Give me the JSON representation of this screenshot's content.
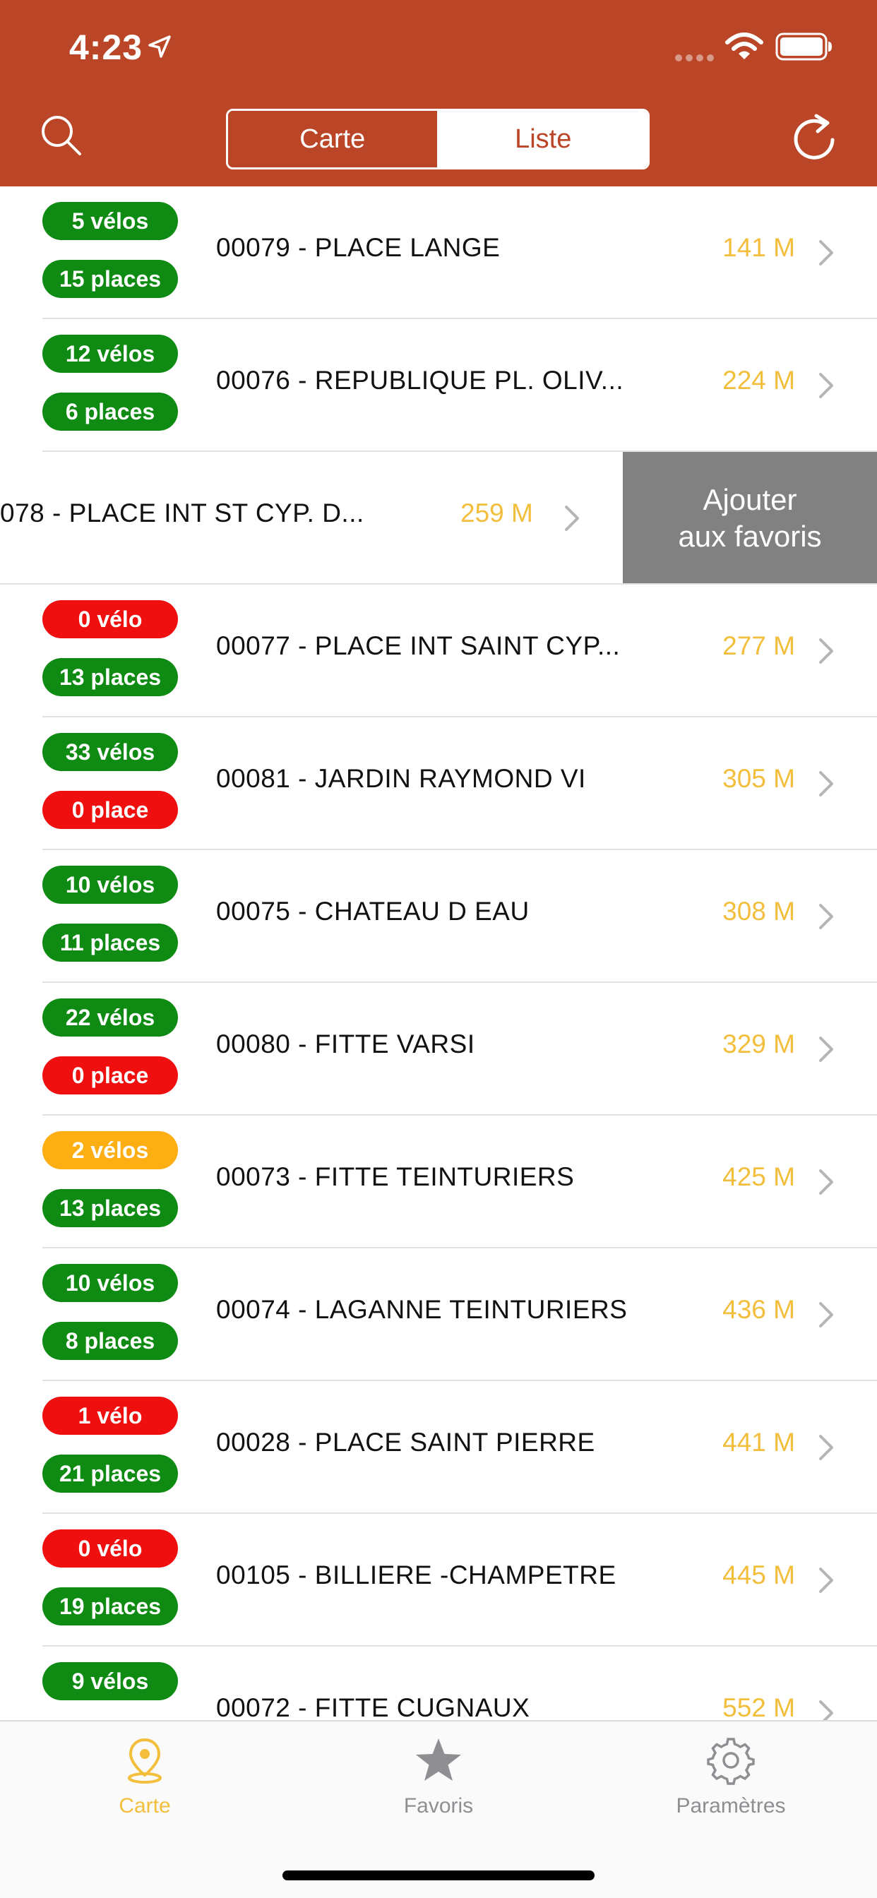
{
  "status_bar": {
    "time": "4:23"
  },
  "header": {
    "segments": {
      "carte": "Carte",
      "liste": "Liste"
    }
  },
  "stations": [
    {
      "bikes": "5 vélos",
      "bikes_color": "green",
      "places": "15 places",
      "places_color": "green",
      "name": "00079 - PLACE LANGE",
      "distance": "141 M"
    },
    {
      "bikes": "12 vélos",
      "bikes_color": "green",
      "places": "6 places",
      "places_color": "green",
      "name": "00076 - REPUBLIQUE PL. OLIV...",
      "distance": "224 M"
    },
    {
      "bikes": "0 vélo",
      "bikes_color": "red",
      "places": "13 places",
      "places_color": "green",
      "name": "00077 - PLACE INT SAINT CYP...",
      "distance": "277 M"
    },
    {
      "bikes": "33 vélos",
      "bikes_color": "green",
      "places": "0 place",
      "places_color": "red",
      "name": "00081 - JARDIN RAYMOND VI",
      "distance": "305 M"
    },
    {
      "bikes": "10 vélos",
      "bikes_color": "green",
      "places": "11 places",
      "places_color": "green",
      "name": "00075 - CHATEAU D EAU",
      "distance": "308 M"
    },
    {
      "bikes": "22 vélos",
      "bikes_color": "green",
      "places": "0 place",
      "places_color": "red",
      "name": "00080 - FITTE VARSI",
      "distance": "329 M"
    },
    {
      "bikes": "2 vélos",
      "bikes_color": "orange",
      "places": "13 places",
      "places_color": "green",
      "name": "00073 - FITTE TEINTURIERS",
      "distance": "425 M"
    },
    {
      "bikes": "10 vélos",
      "bikes_color": "green",
      "places": "8 places",
      "places_color": "green",
      "name": "00074 - LAGANNE TEINTURIERS",
      "distance": "436 M"
    },
    {
      "bikes": "1 vélo",
      "bikes_color": "red",
      "places": "21 places",
      "places_color": "green",
      "name": "00028 - PLACE SAINT PIERRE",
      "distance": "441 M"
    },
    {
      "bikes": "0 vélo",
      "bikes_color": "red",
      "places": "19 places",
      "places_color": "green",
      "name": "00105 - BILLIERE -CHAMPETRE",
      "distance": "445 M"
    },
    {
      "bikes": "9 vélos",
      "bikes_color": "green",
      "places": "",
      "places_color": "green",
      "name": "00072 - FITTE CUGNAUX",
      "distance": "552 M"
    }
  ],
  "swiped_station": {
    "name": "078 - PLACE INT ST CYP. D...",
    "distance": "259 M",
    "action_line1": "Ajouter",
    "action_line2": "aux favoris"
  },
  "tabbar": {
    "carte": "Carte",
    "favoris": "Favoris",
    "parametres": "Paramètres"
  },
  "colors": {
    "header": "#bb4527",
    "green": "#0f8b14",
    "red": "#f00f0f",
    "orange": "#fdae12",
    "distance": "#f3be3b",
    "action": "#818181"
  },
  "icons": [
    "search-icon",
    "refresh-icon",
    "location-arrow-icon",
    "wifi-icon",
    "battery-icon",
    "chevron-right-icon",
    "map-pin-icon",
    "star-icon",
    "gear-icon"
  ]
}
